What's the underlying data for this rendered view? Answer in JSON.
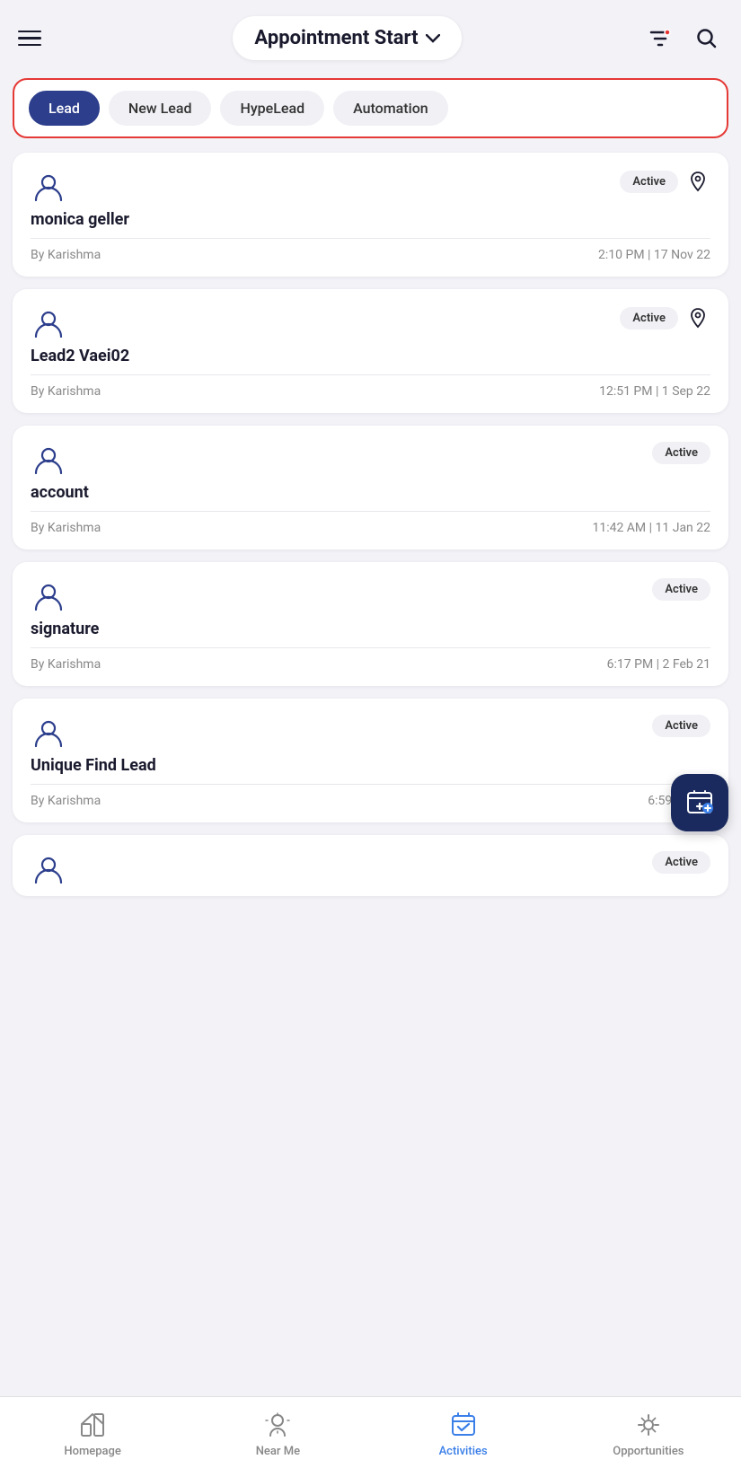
{
  "header": {
    "title": "Appointment Start",
    "menu_icon": "menu-icon",
    "filter_icon": "filter-icon",
    "search_icon": "search-icon"
  },
  "filter_tabs": {
    "items": [
      {
        "id": "lead",
        "label": "Lead",
        "active": true
      },
      {
        "id": "new-lead",
        "label": "New Lead",
        "active": false
      },
      {
        "id": "hype-lead",
        "label": "HypeLead",
        "active": false
      },
      {
        "id": "automation",
        "label": "Automation",
        "active": false
      }
    ]
  },
  "leads": [
    {
      "id": 1,
      "name": "monica geller",
      "by": "By Karishma",
      "time": "2:10 PM | 17 Nov 22",
      "status": "Active",
      "has_location": true
    },
    {
      "id": 2,
      "name": "Lead2 Vaei02",
      "by": "By Karishma",
      "time": "12:51 PM | 1 Sep 22",
      "status": "Active",
      "has_location": true
    },
    {
      "id": 3,
      "name": "account",
      "by": "By Karishma",
      "time": "11:42 AM | 11 Jan 22",
      "status": "Active",
      "has_location": false
    },
    {
      "id": 4,
      "name": "signature",
      "by": "By Karishma",
      "time": "6:17 PM | 2 Feb 21",
      "status": "Active",
      "has_location": false
    },
    {
      "id": 5,
      "name": "Unique Find Lead",
      "by": "By Karishma",
      "time": "6:59 PM | 2",
      "status": "Active",
      "has_location": false
    }
  ],
  "partial_lead": {
    "status": "Active"
  },
  "bottom_nav": {
    "items": [
      {
        "id": "homepage",
        "label": "Homepage",
        "active": false,
        "icon": "homepage-icon"
      },
      {
        "id": "near-me",
        "label": "Near Me",
        "active": false,
        "icon": "near-me-icon"
      },
      {
        "id": "activities",
        "label": "Activities",
        "active": true,
        "icon": "activities-icon"
      },
      {
        "id": "opportunities",
        "label": "Opportunities",
        "active": false,
        "icon": "opportunities-icon"
      }
    ]
  }
}
